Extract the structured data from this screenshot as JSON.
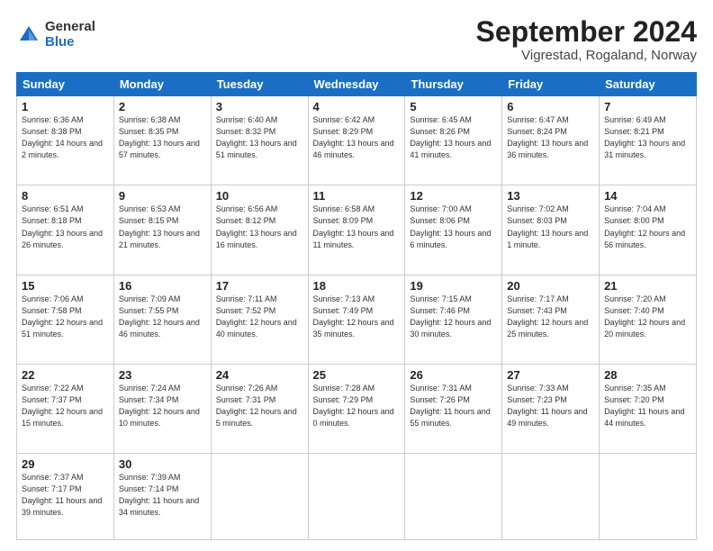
{
  "header": {
    "logo_general": "General",
    "logo_blue": "Blue",
    "month_title": "September 2024",
    "location": "Vigrestad, Rogaland, Norway"
  },
  "days_of_week": [
    "Sunday",
    "Monday",
    "Tuesday",
    "Wednesday",
    "Thursday",
    "Friday",
    "Saturday"
  ],
  "weeks": [
    [
      {
        "day": "1",
        "sunrise": "Sunrise: 6:36 AM",
        "sunset": "Sunset: 8:38 PM",
        "daylight": "Daylight: 14 hours and 2 minutes."
      },
      {
        "day": "2",
        "sunrise": "Sunrise: 6:38 AM",
        "sunset": "Sunset: 8:35 PM",
        "daylight": "Daylight: 13 hours and 57 minutes."
      },
      {
        "day": "3",
        "sunrise": "Sunrise: 6:40 AM",
        "sunset": "Sunset: 8:32 PM",
        "daylight": "Daylight: 13 hours and 51 minutes."
      },
      {
        "day": "4",
        "sunrise": "Sunrise: 6:42 AM",
        "sunset": "Sunset: 8:29 PM",
        "daylight": "Daylight: 13 hours and 46 minutes."
      },
      {
        "day": "5",
        "sunrise": "Sunrise: 6:45 AM",
        "sunset": "Sunset: 8:26 PM",
        "daylight": "Daylight: 13 hours and 41 minutes."
      },
      {
        "day": "6",
        "sunrise": "Sunrise: 6:47 AM",
        "sunset": "Sunset: 8:24 PM",
        "daylight": "Daylight: 13 hours and 36 minutes."
      },
      {
        "day": "7",
        "sunrise": "Sunrise: 6:49 AM",
        "sunset": "Sunset: 8:21 PM",
        "daylight": "Daylight: 13 hours and 31 minutes."
      }
    ],
    [
      {
        "day": "8",
        "sunrise": "Sunrise: 6:51 AM",
        "sunset": "Sunset: 8:18 PM",
        "daylight": "Daylight: 13 hours and 26 minutes."
      },
      {
        "day": "9",
        "sunrise": "Sunrise: 6:53 AM",
        "sunset": "Sunset: 8:15 PM",
        "daylight": "Daylight: 13 hours and 21 minutes."
      },
      {
        "day": "10",
        "sunrise": "Sunrise: 6:56 AM",
        "sunset": "Sunset: 8:12 PM",
        "daylight": "Daylight: 13 hours and 16 minutes."
      },
      {
        "day": "11",
        "sunrise": "Sunrise: 6:58 AM",
        "sunset": "Sunset: 8:09 PM",
        "daylight": "Daylight: 13 hours and 11 minutes."
      },
      {
        "day": "12",
        "sunrise": "Sunrise: 7:00 AM",
        "sunset": "Sunset: 8:06 PM",
        "daylight": "Daylight: 13 hours and 6 minutes."
      },
      {
        "day": "13",
        "sunrise": "Sunrise: 7:02 AM",
        "sunset": "Sunset: 8:03 PM",
        "daylight": "Daylight: 13 hours and 1 minute."
      },
      {
        "day": "14",
        "sunrise": "Sunrise: 7:04 AM",
        "sunset": "Sunset: 8:00 PM",
        "daylight": "Daylight: 12 hours and 56 minutes."
      }
    ],
    [
      {
        "day": "15",
        "sunrise": "Sunrise: 7:06 AM",
        "sunset": "Sunset: 7:58 PM",
        "daylight": "Daylight: 12 hours and 51 minutes."
      },
      {
        "day": "16",
        "sunrise": "Sunrise: 7:09 AM",
        "sunset": "Sunset: 7:55 PM",
        "daylight": "Daylight: 12 hours and 46 minutes."
      },
      {
        "day": "17",
        "sunrise": "Sunrise: 7:11 AM",
        "sunset": "Sunset: 7:52 PM",
        "daylight": "Daylight: 12 hours and 40 minutes."
      },
      {
        "day": "18",
        "sunrise": "Sunrise: 7:13 AM",
        "sunset": "Sunset: 7:49 PM",
        "daylight": "Daylight: 12 hours and 35 minutes."
      },
      {
        "day": "19",
        "sunrise": "Sunrise: 7:15 AM",
        "sunset": "Sunset: 7:46 PM",
        "daylight": "Daylight: 12 hours and 30 minutes."
      },
      {
        "day": "20",
        "sunrise": "Sunrise: 7:17 AM",
        "sunset": "Sunset: 7:43 PM",
        "daylight": "Daylight: 12 hours and 25 minutes."
      },
      {
        "day": "21",
        "sunrise": "Sunrise: 7:20 AM",
        "sunset": "Sunset: 7:40 PM",
        "daylight": "Daylight: 12 hours and 20 minutes."
      }
    ],
    [
      {
        "day": "22",
        "sunrise": "Sunrise: 7:22 AM",
        "sunset": "Sunset: 7:37 PM",
        "daylight": "Daylight: 12 hours and 15 minutes."
      },
      {
        "day": "23",
        "sunrise": "Sunrise: 7:24 AM",
        "sunset": "Sunset: 7:34 PM",
        "daylight": "Daylight: 12 hours and 10 minutes."
      },
      {
        "day": "24",
        "sunrise": "Sunrise: 7:26 AM",
        "sunset": "Sunset: 7:31 PM",
        "daylight": "Daylight: 12 hours and 5 minutes."
      },
      {
        "day": "25",
        "sunrise": "Sunrise: 7:28 AM",
        "sunset": "Sunset: 7:29 PM",
        "daylight": "Daylight: 12 hours and 0 minutes."
      },
      {
        "day": "26",
        "sunrise": "Sunrise: 7:31 AM",
        "sunset": "Sunset: 7:26 PM",
        "daylight": "Daylight: 11 hours and 55 minutes."
      },
      {
        "day": "27",
        "sunrise": "Sunrise: 7:33 AM",
        "sunset": "Sunset: 7:23 PM",
        "daylight": "Daylight: 11 hours and 49 minutes."
      },
      {
        "day": "28",
        "sunrise": "Sunrise: 7:35 AM",
        "sunset": "Sunset: 7:20 PM",
        "daylight": "Daylight: 11 hours and 44 minutes."
      }
    ],
    [
      {
        "day": "29",
        "sunrise": "Sunrise: 7:37 AM",
        "sunset": "Sunset: 7:17 PM",
        "daylight": "Daylight: 11 hours and 39 minutes."
      },
      {
        "day": "30",
        "sunrise": "Sunrise: 7:39 AM",
        "sunset": "Sunset: 7:14 PM",
        "daylight": "Daylight: 11 hours and 34 minutes."
      },
      null,
      null,
      null,
      null,
      null
    ]
  ]
}
